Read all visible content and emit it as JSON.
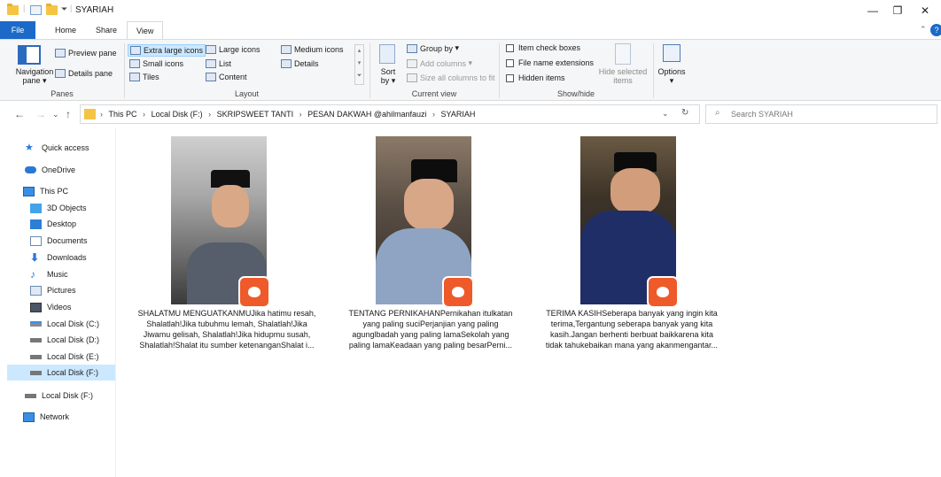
{
  "window": {
    "title": "SYARIAH",
    "controls": {
      "minimize": "—",
      "maximize": "❐",
      "close": "✕"
    },
    "help": "?"
  },
  "tabs": [
    "File",
    "Home",
    "Share",
    "View"
  ],
  "ribbon": {
    "panes": {
      "navigation_pane": "Navigation pane",
      "navigation_pane_arrow": "▾",
      "preview_pane": "Preview pane",
      "details_pane": "Details pane",
      "label": "Panes"
    },
    "layout": {
      "extra_large": "Extra large icons",
      "large": "Large icons",
      "medium": "Medium icons",
      "small": "Small icons",
      "list": "List",
      "details": "Details",
      "tiles": "Tiles",
      "content": "Content",
      "label": "Layout"
    },
    "current_view": {
      "sort_by": "Sort by",
      "group_by": "Group by",
      "add_columns": "Add columns",
      "size_columns": "Size all columns to fit",
      "label": "Current view"
    },
    "show_hide": {
      "item_check_boxes": "Item check boxes",
      "file_name_extensions": "File name extensions",
      "hidden_items": "Hidden items",
      "hide_selected": "Hide selected items",
      "label": "Show/hide"
    },
    "options": "Options"
  },
  "address": {
    "crumbs": [
      "This PC",
      "Local Disk (F:)",
      "SKRIPSWEET TANTI",
      "PESAN DAKWAH @ahilmanfauzi",
      "SYARIAH"
    ],
    "separator": "›",
    "search_placeholder": "Search SYARIAH"
  },
  "sidebar": {
    "items": [
      {
        "label": "Quick access",
        "icon": "star-icon"
      },
      {
        "label": "OneDrive",
        "icon": "cloud-icon"
      },
      {
        "label": "This PC",
        "icon": "monitor-icon"
      },
      {
        "label": "3D Objects",
        "icon": "cube-icon"
      },
      {
        "label": "Desktop",
        "icon": "desktop-icon"
      },
      {
        "label": "Documents",
        "icon": "document-icon"
      },
      {
        "label": "Downloads",
        "icon": "download-icon"
      },
      {
        "label": "Music",
        "icon": "music-icon"
      },
      {
        "label": "Pictures",
        "icon": "picture-icon"
      },
      {
        "label": "Videos",
        "icon": "video-icon"
      },
      {
        "label": "Local Disk (C:)",
        "icon": "drive-icon"
      },
      {
        "label": "Local Disk (D:)",
        "icon": "drive-icon"
      },
      {
        "label": "Local Disk (E:)",
        "icon": "drive-icon"
      },
      {
        "label": "Local Disk (F:)",
        "icon": "drive-icon",
        "selected": true
      },
      {
        "label": "Local Disk (F:)",
        "icon": "drive-icon"
      },
      {
        "label": "Network",
        "icon": "network-icon"
      }
    ]
  },
  "files": [
    {
      "lines": [
        "SHALATMU MENGUATKANMUJika hatimu resah,",
        "Shalatlah!Jika tubuhmu lemah, Shalatlah!Jika",
        "Jiwamu gelisah, Shalatlah!Jika hidupmu susah,",
        "Shalatlah!Shalat itu sumber ketenanganShalat i..."
      ]
    },
    {
      "lines": [
        "TENTANG PERNIKAHANPernikahan itulkatan",
        "yang paling suciPerjanjian yang paling",
        "agunglbadah yang paling lamaSekolah yang",
        "paling lamaKeadaan yang paling besarPerni..."
      ]
    },
    {
      "lines": [
        "TERIMA KASIHSeberapa banyak yang ingin kita",
        "terima,Tergantung seberapa banyak yang kita",
        "kasih.Jangan berhenti berbuat baikkarena kita",
        "tidak tahukebaikan mana yang akanmengantar..."
      ]
    }
  ],
  "colors": {
    "accent": "#1b6ac9",
    "selected": "#cce8ff",
    "vlc": "#ee5a2a",
    "folder": "#f5c443"
  }
}
